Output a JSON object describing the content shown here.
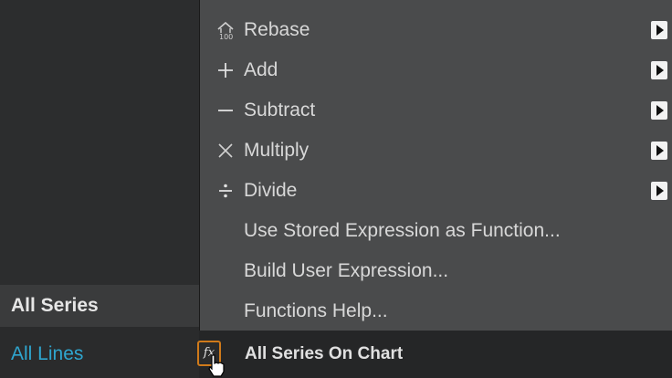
{
  "menu": {
    "items": [
      {
        "icon": "rebase-icon",
        "label": "Rebase",
        "has_submenu": true
      },
      {
        "icon": "plus-icon",
        "label": "Add",
        "has_submenu": true
      },
      {
        "icon": "minus-icon",
        "label": "Subtract",
        "has_submenu": true
      },
      {
        "icon": "multiply-icon",
        "label": "Multiply",
        "has_submenu": true
      },
      {
        "icon": "divide-icon",
        "label": "Divide",
        "has_submenu": true
      },
      {
        "icon": "",
        "label": "Use Stored Expression as Function...",
        "has_submenu": false
      },
      {
        "icon": "",
        "label": "Build User Expression...",
        "has_submenu": false
      },
      {
        "icon": "",
        "label": "Functions Help...",
        "has_submenu": false
      }
    ]
  },
  "left_panel": {
    "all_series": "All Series",
    "all_lines": "All Lines"
  },
  "bottom_bar": {
    "label": "All Series On Chart",
    "fx_icon": "fx-icon",
    "fx_glyph": "fx"
  },
  "colors": {
    "menu_bg": "#4a4b4c",
    "link": "#2fa6cf",
    "fx_border": "#d07a1a"
  }
}
